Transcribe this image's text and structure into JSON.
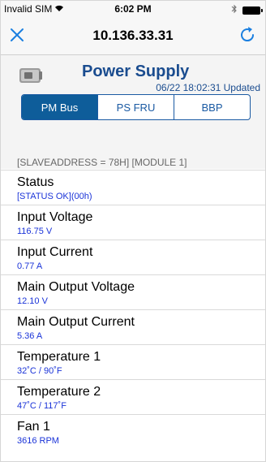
{
  "status_bar": {
    "carrier": "Invalid SIM",
    "time": "6:02 PM"
  },
  "nav": {
    "title": "10.136.33.31",
    "close_icon": "close-icon",
    "refresh_icon": "refresh-icon"
  },
  "header": {
    "title": "Power Supply",
    "updated": "06/22 18:02:31 Updated",
    "tabs": [
      {
        "label": "PM Bus",
        "active": true
      },
      {
        "label": "PS FRU",
        "active": false
      },
      {
        "label": "BBP",
        "active": false
      }
    ],
    "slave_info": "[SLAVEADDRESS = 78H] [MODULE 1]"
  },
  "items": [
    {
      "label": "Status",
      "value": "[STATUS OK](00h)"
    },
    {
      "label": "Input Voltage",
      "value": "116.75 V"
    },
    {
      "label": "Input Current",
      "value": "0.77 A"
    },
    {
      "label": "Main Output Voltage",
      "value": "12.10 V"
    },
    {
      "label": "Main Output Current",
      "value": "5.36 A"
    },
    {
      "label": "Temperature 1",
      "value": "32˚C / 90˚F"
    },
    {
      "label": "Temperature 2",
      "value": "47˚C / 117˚F"
    },
    {
      "label": "Fan 1",
      "value": "3616 RPM"
    }
  ],
  "colors": {
    "accent": "#1a5aa3",
    "value_text": "#1a33d8",
    "title_text": "#1a4c8f"
  }
}
